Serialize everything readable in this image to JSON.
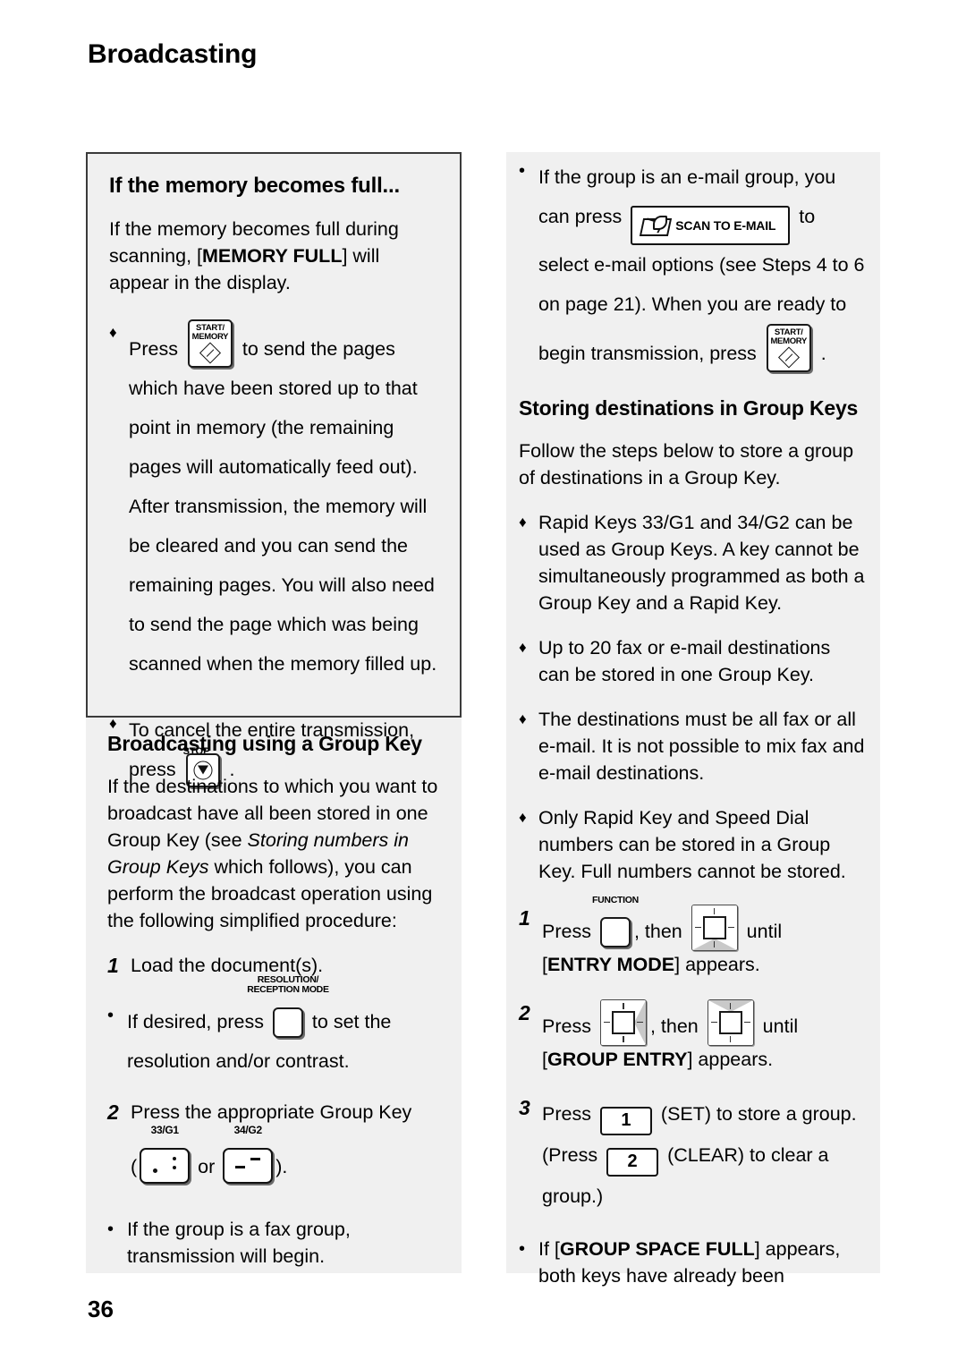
{
  "page": {
    "header": "Broadcasting",
    "number": "36"
  },
  "left_column": {
    "callout": {
      "title": "If the memory becomes full...",
      "intro_pre": "If the memory becomes full during scanning, [",
      "intro_bold": "MEMORY FULL",
      "intro_post": "] will appear in the display.",
      "bullets": [
        {
          "mark": "♦",
          "pre": "Press ",
          "key": "START/MEMORY",
          "post": " to send the pages which have been stored up to that point in memory (the remaining pages will automatically feed out). After transmission, the memory will be cleared and you can send the remaining pages. You will also need to send the page which was being scanned when the memory filled up."
        },
        {
          "mark": "♦",
          "pre": "To cancel the entire transmission, press ",
          "key": "STOP",
          "post": " ."
        }
      ]
    },
    "section": {
      "title": "Broadcasting using a Group Key",
      "intro_a": "If the destinations to which you want to broadcast have all been stored in one Group Key (see ",
      "intro_italic": "Storing numbers in Group Keys",
      "intro_b": " which follows), you can perform the broadcast operation using the following simplified procedure:",
      "steps": [
        {
          "num": "1",
          "text": "Load the document(s)."
        },
        {
          "num": "2",
          "text": "Press the appropriate Group Key"
        }
      ],
      "sub_bullet_resolution": {
        "mark": "•",
        "pre": "If desired, press ",
        "key_label_line1": "RESOLUTION/",
        "key_label_line2": "RECEPTION MODE",
        "post": " to set the resolution and/or contrast."
      },
      "group_key_line": {
        "open": "(",
        "key1_label": "33/G1",
        "or": " or ",
        "key2_label": "34/G2",
        "close": ")."
      },
      "final_bullet": {
        "mark": "•",
        "text": "If the group is a fax group, transmission will begin."
      }
    }
  },
  "right_column": {
    "email_bullet": {
      "mark": "•",
      "pre": "If the group is an e-mail group, you can press ",
      "key": "SCAN TO E-MAIL",
      "mid": " to select e-mail options (see Steps 4 to 6 on page 21). When you are ready to begin transmission, press ",
      "key2": "START/MEMORY",
      "post": " ."
    },
    "section": {
      "title": "Storing destinations in Group Keys",
      "intro": "Follow the steps below to store a group of destinations in a Group Key.",
      "bullets": [
        {
          "mark": "♦",
          "text": "Rapid Keys 33/G1 and 34/G2 can be used as Group Keys. A key cannot be simultaneously programmed as both a Group Key and a Rapid Key."
        },
        {
          "mark": "♦",
          "text": "Up to 20 fax or e-mail destinations can be stored in one Group Key."
        },
        {
          "mark": "♦",
          "text": "The destinations must be all fax or all e-mail. It is not possible to mix fax and e-mail destinations."
        },
        {
          "mark": "♦",
          "text": "Only Rapid Key and Speed Dial numbers can be stored in a Group Key. Full numbers cannot be stored."
        }
      ],
      "step1": {
        "num": "1",
        "pre": "Press ",
        "key_label": "FUNCTION",
        "mid": ", then ",
        "post": " until ",
        "result_open": "[",
        "result_bold": "ENTRY MODE",
        "result_close": "] appears."
      },
      "step2": {
        "num": "2",
        "pre": "Press ",
        "mid": ", then ",
        "post": " until ",
        "result_open": "[",
        "result_bold": "GROUP ENTRY",
        "result_close": "] appears."
      },
      "step3": {
        "num": "3",
        "pre": "Press ",
        "key1": "1",
        "mid": " (SET) to store a group. (Press ",
        "key2": "2",
        "post": " (CLEAR) to clear a group.)"
      },
      "warning_bullet": {
        "mark": "•",
        "pre": "If [",
        "bold": "GROUP SPACE FULL",
        "post": "] appears, both keys have already been"
      }
    }
  },
  "colors": {
    "column_background": "#f0f0f0",
    "callout_border": "#3b3b3b",
    "text": "#000000",
    "pad_shade": "#c9c9c9"
  }
}
